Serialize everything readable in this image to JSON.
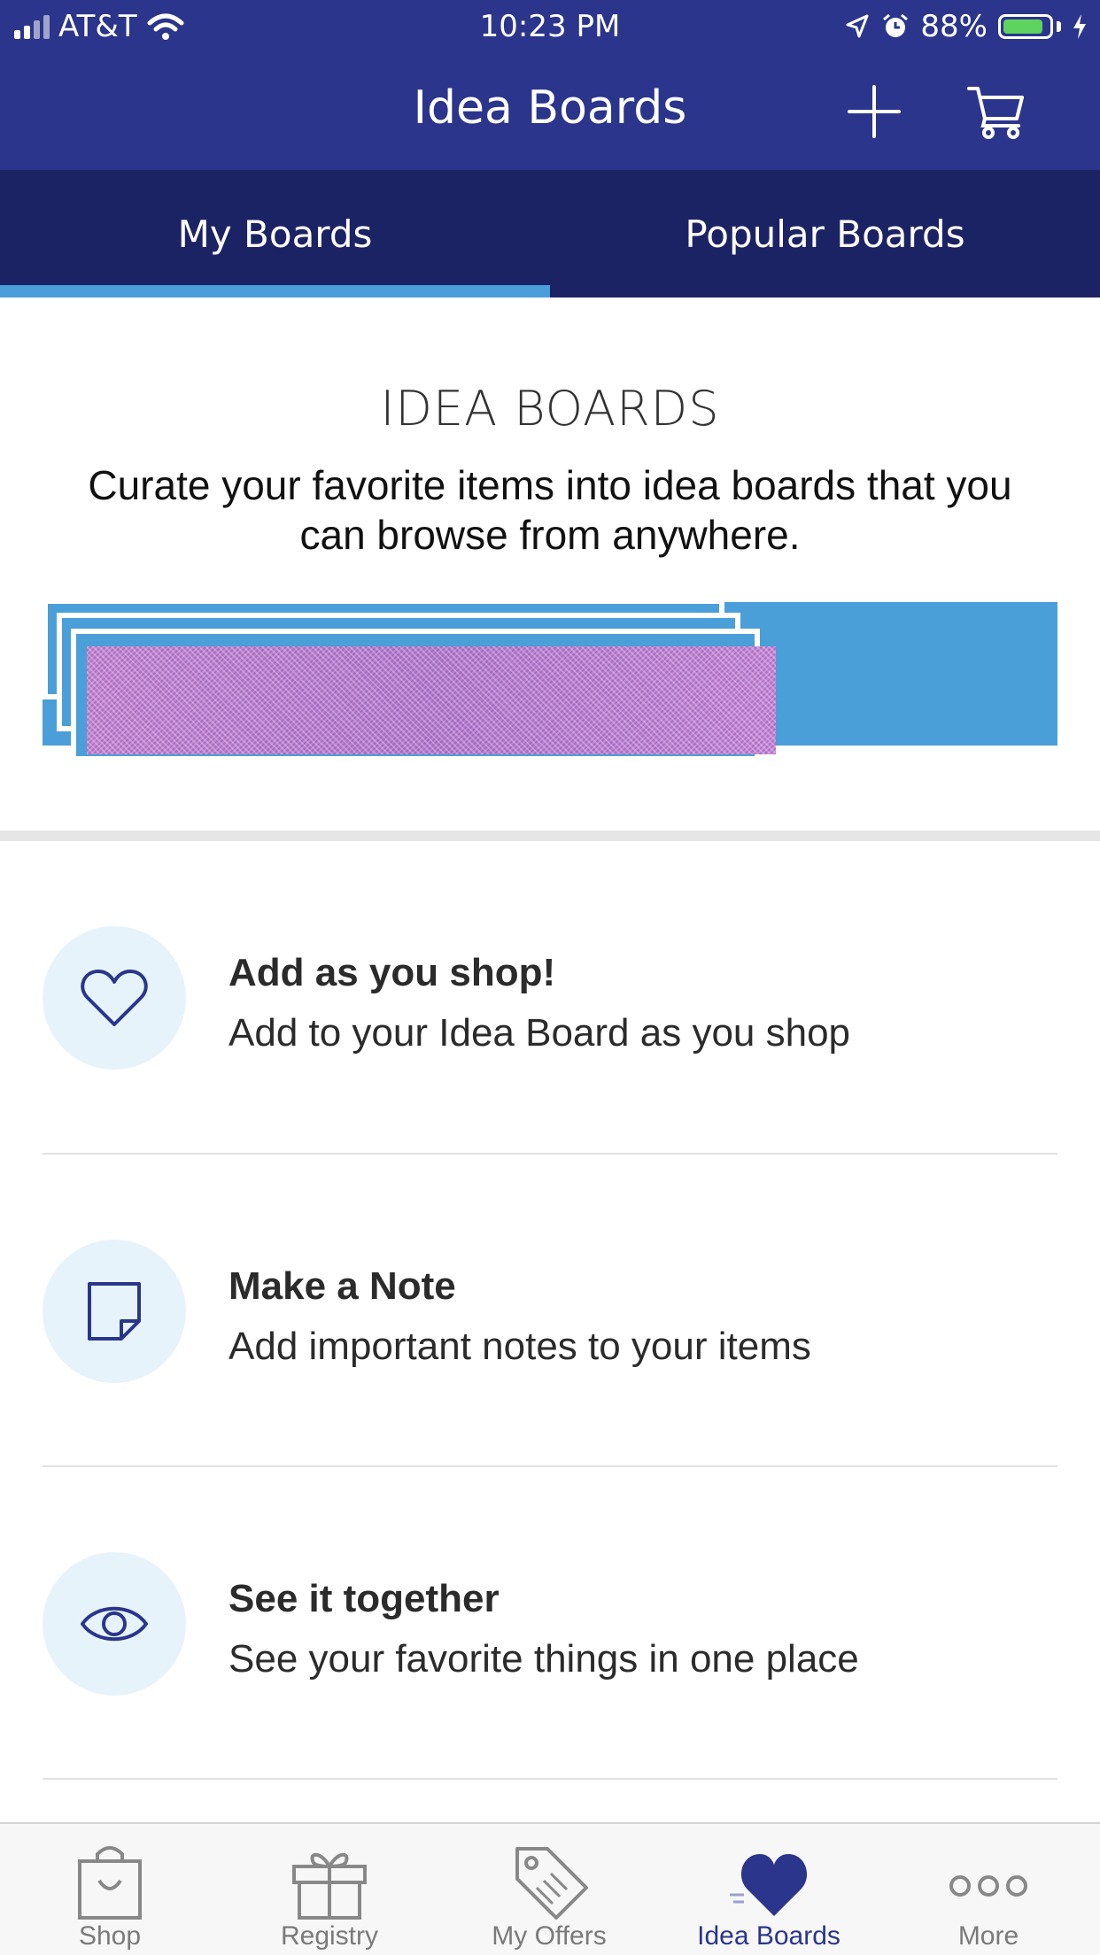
{
  "status_bar": {
    "carrier": "AT&T",
    "time": "10:23 PM",
    "battery_percent": "88%",
    "battery_level": 0.88
  },
  "header": {
    "title": "Idea Boards",
    "add_icon": "plus-icon",
    "cart_icon": "cart-icon"
  },
  "tabs": [
    {
      "label": "My Boards",
      "active": true
    },
    {
      "label": "Popular Boards",
      "active": false
    }
  ],
  "hero": {
    "title": "IDEA BOARDS",
    "text": "Curate your favorite items into idea boards that you can browse from anywhere."
  },
  "features": [
    {
      "icon": "heart-outline-icon",
      "title": "Add as you shop!",
      "description": "Add to your Idea Board as you shop"
    },
    {
      "icon": "note-icon",
      "title": "Make a Note",
      "description": "Add important notes to your items"
    },
    {
      "icon": "eye-icon",
      "title": "See it together",
      "description": "See your favorite things in one place"
    }
  ],
  "bottom_tabs": [
    {
      "label": "Shop",
      "icon": "shopping-bag-icon",
      "active": false
    },
    {
      "label": "Registry",
      "icon": "gift-icon",
      "active": false
    },
    {
      "label": "My Offers",
      "icon": "tag-icon",
      "active": false
    },
    {
      "label": "Idea Boards",
      "icon": "heart-icon",
      "active": true
    },
    {
      "label": "More",
      "icon": "more-dots-icon",
      "active": false
    }
  ],
  "colors": {
    "header_bg": "#2b358c",
    "tabs_bg": "#1c2365",
    "accent": "#4a9fd8",
    "icon_circle_bg": "#e7f3fb",
    "active_tab_text": "#2b358c"
  }
}
